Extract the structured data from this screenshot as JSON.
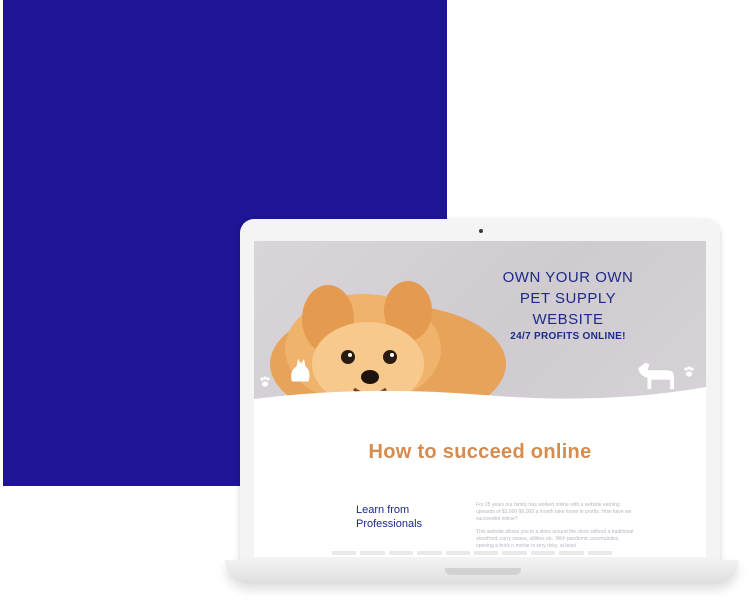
{
  "hero": {
    "title_lines": [
      "OWN YOUR OWN",
      "PET SUPPLY",
      "WEBSITE"
    ],
    "subtitle": "24/7 PROFITS ONLINE!"
  },
  "section": {
    "heading": "How to succeed online",
    "side_label_lines": [
      "Learn from",
      "Professionals"
    ],
    "paragraphs": [
      "For 25 years our family has worked online with a website earning upwards of $3,000-$6,000 a month take home in profits. How have we succeeded online?",
      "This website allows you to a store around the clock without a traditional storefront, carry issues, utilities etc. With pandemic uncertainties, opening a brick n mortar is very risky, at least"
    ]
  },
  "colors": {
    "background_block": "#1e1596",
    "title_blue": "#1d2a86",
    "heading_orange": "#d68b4f"
  },
  "icons": [
    "paw-icon",
    "dog-silhouette-icon",
    "cat-silhouette-icon",
    "camera-icon"
  ]
}
